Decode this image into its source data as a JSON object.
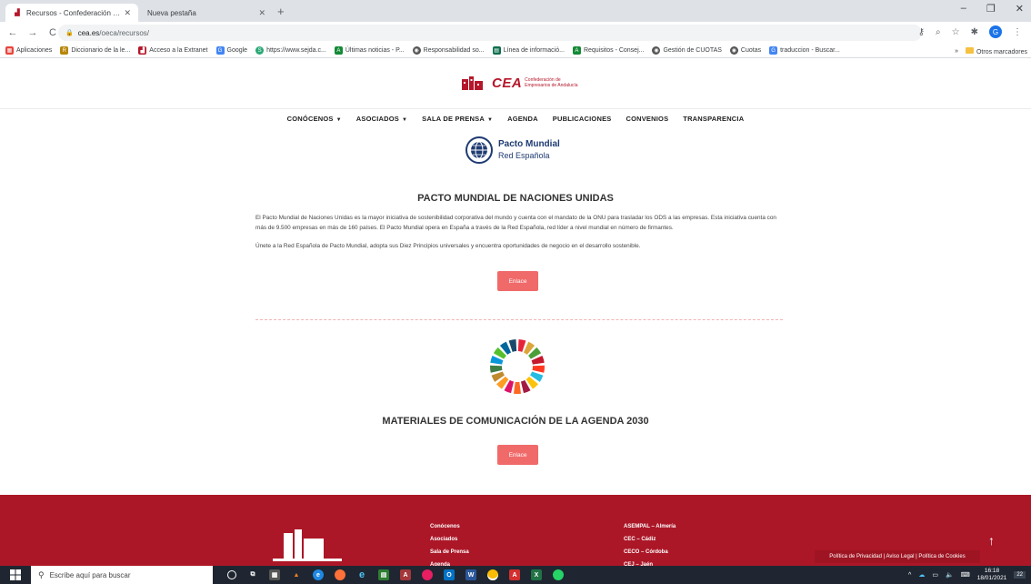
{
  "browser": {
    "tabs": [
      {
        "title": "Recursos - Confederación de Em",
        "active": true
      },
      {
        "title": "Nueva pestaña",
        "active": false
      }
    ],
    "url_host": "cea.es",
    "url_path": "/oeca/recursos/",
    "bookmarks": [
      {
        "label": "Aplicaciones",
        "icon": "apps-grid-icon",
        "color": "#e8453c"
      },
      {
        "label": "Diccionario de la le...",
        "icon": "rae-icon",
        "color": "#b8860b"
      },
      {
        "label": "Acceso a la Extranet",
        "icon": "cea-icon",
        "color": "#b5172a"
      },
      {
        "label": "Google",
        "icon": "google-icon",
        "color": "#4285f4"
      },
      {
        "label": "https://www.sejda.c...",
        "icon": "sejda-icon",
        "color": "#2aa876"
      },
      {
        "label": "Últimas noticias - P...",
        "icon": "junta-icon",
        "color": "#138a36"
      },
      {
        "label": "Responsabilidad so...",
        "icon": "globe-icon",
        "color": "#555555"
      },
      {
        "label": "Línea de informació...",
        "icon": "doc-icon",
        "color": "#0b6e4f"
      },
      {
        "label": "Requisitos - Consej...",
        "icon": "junta-icon",
        "color": "#138a36"
      },
      {
        "label": "Gestión de CUOTAS",
        "icon": "globe-icon",
        "color": "#555555"
      },
      {
        "label": "Cuotas",
        "icon": "globe-icon",
        "color": "#555555"
      },
      {
        "label": "traduccion - Buscar...",
        "icon": "google-icon",
        "color": "#4285f4"
      }
    ],
    "bookmarks_more": "»",
    "other_bookmarks": "Otros marcadores",
    "profile_initial": "G"
  },
  "site": {
    "logo_text": "CEA",
    "logo_sub_1": "Confederación de",
    "logo_sub_2": "Empresarios de Andalucía",
    "nav": [
      {
        "label": "CONÓCENOS",
        "dropdown": true
      },
      {
        "label": "ASOCIADOS",
        "dropdown": true
      },
      {
        "label": "SALA DE PRENSA",
        "dropdown": true
      },
      {
        "label": "AGENDA",
        "dropdown": false
      },
      {
        "label": "PUBLICACIONES",
        "dropdown": false
      },
      {
        "label": "CONVENIOS",
        "dropdown": false
      },
      {
        "label": "TRANSPARENCIA",
        "dropdown": false
      }
    ],
    "pacto_logo_line1": "Pacto Mundial",
    "pacto_logo_line2": "Red Española",
    "section1": {
      "title": "PACTO MUNDIAL DE NACIONES UNIDAS",
      "para1": "El Pacto Mundial de Naciones Unidas es la mayor iniciativa de sostenibilidad corporativa del mundo y cuenta con el mandato de la ONU para trasladar los ODS a las empresas. Esta iniciativa cuenta con más de 9.500 empresas en más de 160 países. El Pacto Mundial opera en España a través de la Red Española, red líder a nivel mundial en número de firmantes.",
      "para2": "Únete a la Red Española de Pacto Mundial, adopta sus Diez Principios universales y encuentra oportunidades de negocio en el desarrollo sostenible.",
      "button": "Enlace"
    },
    "section2": {
      "title": "MATERIALES DE COMUNICACIÓN DE LA AGENDA 2030",
      "button": "Enlace"
    },
    "footer": {
      "col1": [
        "Conócenos",
        "Asociados",
        "Sala de Prensa",
        "Agenda"
      ],
      "col2": [
        "ASEMPAL – Almería",
        "CEC – Cádiz",
        "CECO – Córdoba",
        "CEJ – Jaén"
      ],
      "cookie_text": "Política de Privacidad | Aviso Legal | Política de Cookies",
      "back_to_top": "↑"
    },
    "colors": {
      "brand": "#b5172a",
      "button": "#f06a6a",
      "footer": "#ab1727"
    }
  },
  "taskbar": {
    "search_placeholder": "Escribe aquí para buscar",
    "time": "16:18",
    "date": "18/01/2021",
    "notifications": "22"
  }
}
